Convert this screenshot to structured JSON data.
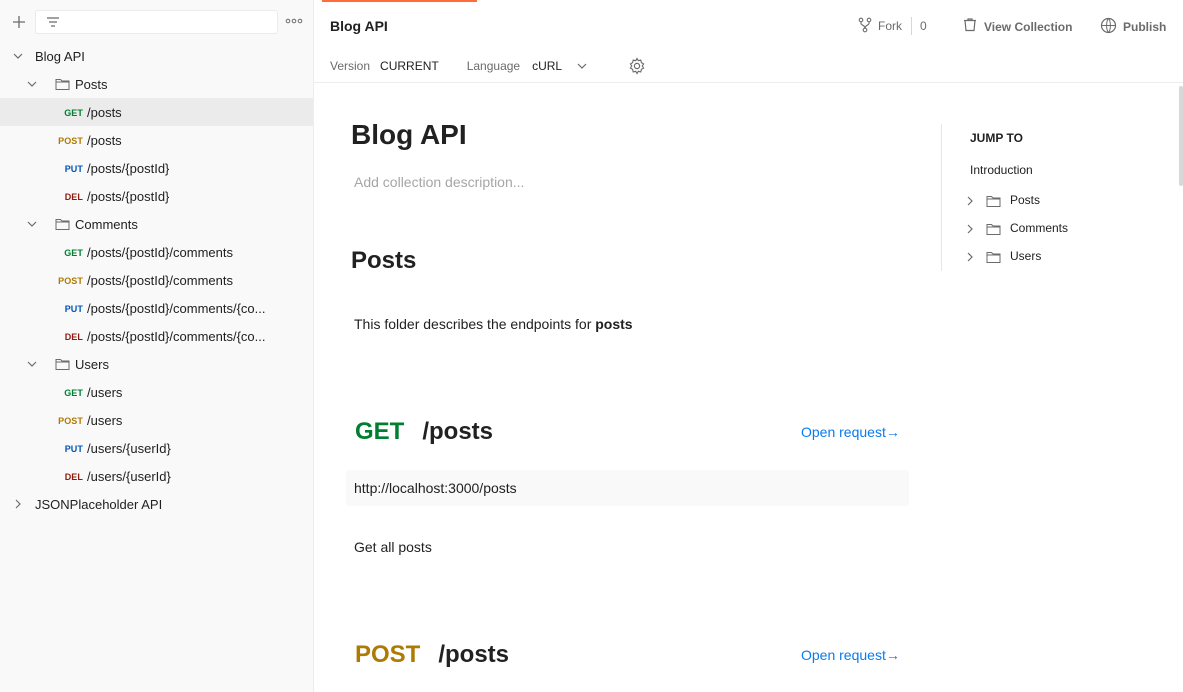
{
  "sidebar": {
    "filter_placeholder": "",
    "collections": [
      {
        "name": "Blog API",
        "expanded": true,
        "folders": [
          {
            "name": "Posts",
            "requests": [
              {
                "method": "GET",
                "path": "/posts",
                "selected": true
              },
              {
                "method": "POST",
                "path": "/posts"
              },
              {
                "method": "PUT",
                "path": "/posts/{postId}"
              },
              {
                "method": "DEL",
                "path": "/posts/{postId}"
              }
            ]
          },
          {
            "name": "Comments",
            "requests": [
              {
                "method": "GET",
                "path": "/posts/{postId}/comments"
              },
              {
                "method": "POST",
                "path": "/posts/{postId}/comments"
              },
              {
                "method": "PUT",
                "path": "/posts/{postId}/comments/{co..."
              },
              {
                "method": "DEL",
                "path": "/posts/{postId}/comments/{co..."
              }
            ]
          },
          {
            "name": "Users",
            "requests": [
              {
                "method": "GET",
                "path": "/users"
              },
              {
                "method": "POST",
                "path": "/users"
              },
              {
                "method": "PUT",
                "path": "/users/{userId}"
              },
              {
                "method": "DEL",
                "path": "/users/{userId}"
              }
            ]
          }
        ]
      },
      {
        "name": "JSONPlaceholder API",
        "expanded": false
      }
    ]
  },
  "header": {
    "title": "Blog API",
    "fork_label": "Fork",
    "fork_count": "0",
    "view_collection_label": "View Collection",
    "publish_label": "Publish",
    "version_label": "Version",
    "version_value": "CURRENT",
    "language_label": "Language",
    "language_value": "cURL"
  },
  "content": {
    "title": "Blog API",
    "description_placeholder": "Add collection description...",
    "section_title": "Posts",
    "section_text_prefix": "This folder describes the endpoints for ",
    "section_text_bold": "posts",
    "requests": [
      {
        "method": "GET",
        "path": "/posts",
        "open_label": "Open request→",
        "url": "http://localhost:3000/posts",
        "description": "Get all posts"
      },
      {
        "method": "POST",
        "path": "/posts",
        "open_label": "Open request→"
      }
    ]
  },
  "jump_to": {
    "title": "JUMP TO",
    "intro": "Introduction",
    "items": [
      "Posts",
      "Comments",
      "Users"
    ]
  },
  "colors": {
    "get": "#007f31",
    "post": "#ad7a03",
    "put": "#0053b8",
    "del": "#8e1a10",
    "link": "#097bed",
    "accent": "#ff6c37"
  },
  "icons": [
    "plus-icon",
    "filter-icon",
    "more-icon",
    "chevron-down-icon",
    "chevron-right-icon",
    "folder-icon",
    "fork-icon",
    "view-collection-icon",
    "publish-icon",
    "gear-icon"
  ]
}
